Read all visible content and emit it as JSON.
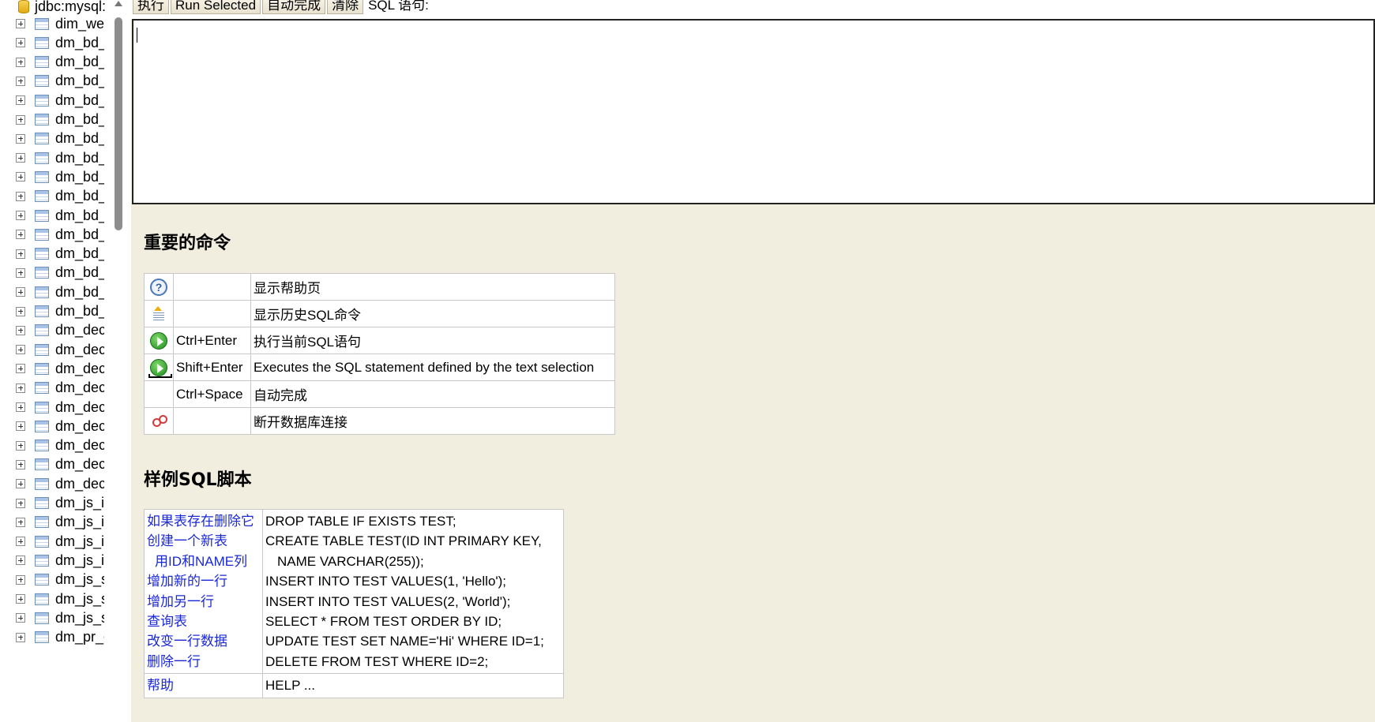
{
  "tree": {
    "root_label": "jdbc:mysql:",
    "items": [
      "dim_wea",
      "dm_bd_",
      "dm_bd_",
      "dm_bd_",
      "dm_bd_",
      "dm_bd_",
      "dm_bd_",
      "dm_bd_",
      "dm_bd_",
      "dm_bd_",
      "dm_bd_",
      "dm_bd_",
      "dm_bd_",
      "dm_bd_",
      "dm_bd_",
      "dm_bd_",
      "dm_dec",
      "dm_dec",
      "dm_dec",
      "dm_dec",
      "dm_dec",
      "dm_dec",
      "dm_dec",
      "dm_dec",
      "dm_dec",
      "dm_js_i",
      "dm_js_i",
      "dm_js_i",
      "dm_js_i",
      "dm_js_s",
      "dm_js_s",
      "dm_js_s",
      "dm_pr_c"
    ]
  },
  "toolbar": {
    "execute": "执行",
    "run_selected": "Run Selected",
    "autocomplete": "自动完成",
    "clear": "清除",
    "sql_label": "SQL 语句:"
  },
  "sql_input": {
    "value": ""
  },
  "commands": {
    "title": "重要的命令",
    "rows": [
      {
        "icon": "help-icon",
        "key": "",
        "desc": "显示帮助页"
      },
      {
        "icon": "history-icon",
        "key": "",
        "desc": "显示历史SQL命令"
      },
      {
        "icon": "run-icon",
        "key": "Ctrl+Enter",
        "desc": "执行当前SQL语句"
      },
      {
        "icon": "run-selected-icon",
        "key": "Shift+Enter",
        "desc": "Executes the SQL statement defined by the text selection"
      },
      {
        "icon": "",
        "key": "Ctrl+Space",
        "desc": "自动完成"
      },
      {
        "icon": "disconnect-icon",
        "key": "",
        "desc": "断开数据库连接"
      }
    ]
  },
  "samples": {
    "title": "样例SQL脚本",
    "links": {
      "drop": "如果表存在删除它",
      "create": "创建一个新表",
      "create_cols": "用ID和NAME列",
      "insert1": "增加新的一行",
      "insert2": "增加另一行",
      "query": "查询表",
      "update": "改变一行数据",
      "delete": "删除一行",
      "help": "帮助"
    },
    "sql": {
      "drop": "DROP TABLE IF EXISTS TEST;",
      "create": "CREATE TABLE TEST(ID INT PRIMARY KEY,",
      "create_cols": "NAME VARCHAR(255));",
      "insert1": "INSERT INTO TEST VALUES(1, 'Hello');",
      "insert2": "INSERT INTO TEST VALUES(2, 'World');",
      "query": "SELECT * FROM TEST ORDER BY ID;",
      "update": "UPDATE TEST SET NAME='Hi' WHERE ID=1;",
      "delete": "DELETE FROM TEST WHERE ID=2;",
      "help": "HELP ..."
    }
  }
}
